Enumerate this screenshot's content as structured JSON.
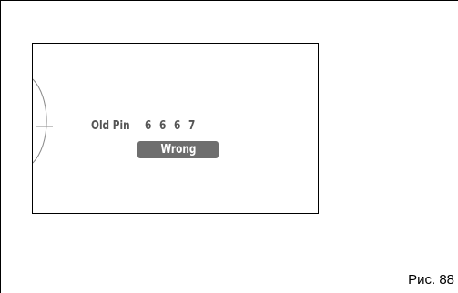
{
  "display": {
    "old_pin_label": "Old Pin",
    "pin_digits": [
      "6",
      "6",
      "6",
      "7"
    ],
    "status_badge": "Wrong"
  },
  "caption": "Рис. 88",
  "colors": {
    "text_gray": "#555555",
    "badge_background": "#6e6e6e",
    "badge_text": "#ffffff",
    "line": "#000000"
  }
}
